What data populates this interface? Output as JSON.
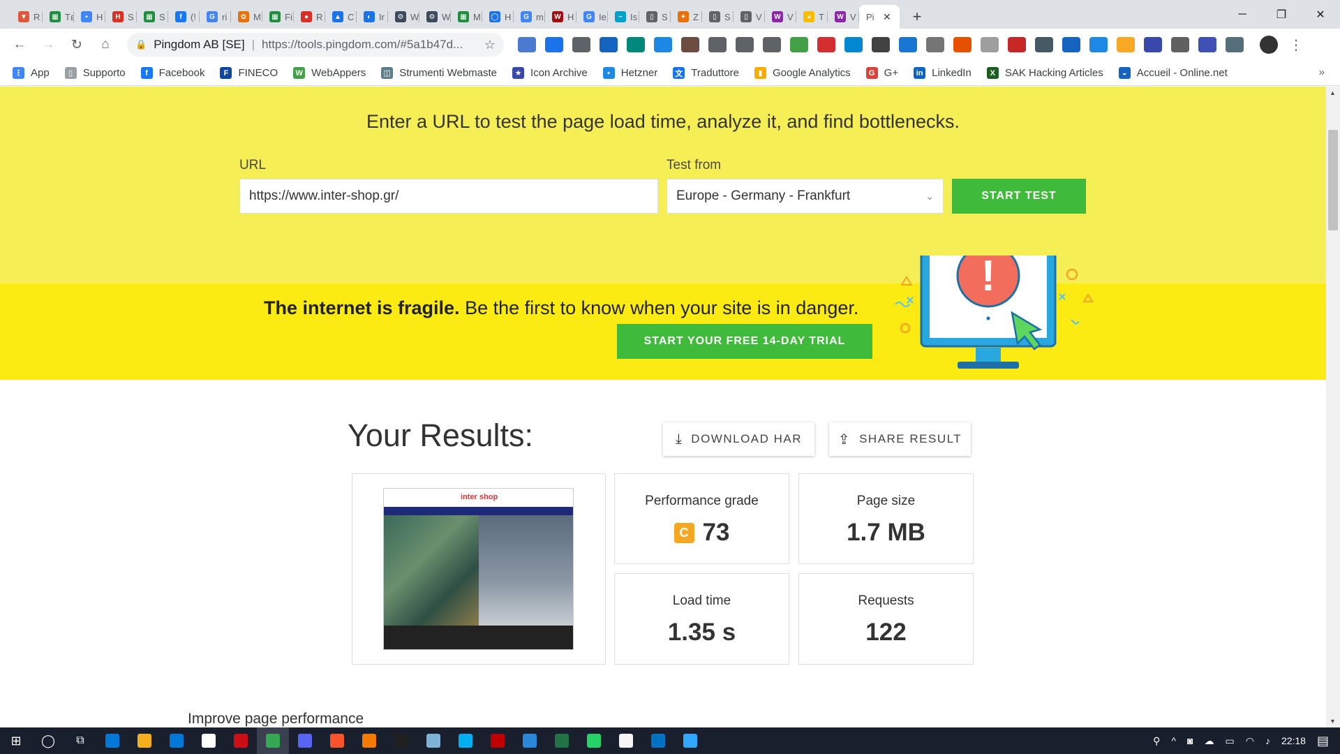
{
  "browser": {
    "tabs": [
      {
        "label": "R",
        "color": "#e0583c",
        "glyph": "▼"
      },
      {
        "label": "Tε",
        "color": "#1e8e3e",
        "glyph": "▦"
      },
      {
        "label": "H",
        "color": "#4285f4",
        "glyph": "▪"
      },
      {
        "label": "S",
        "color": "#d93025",
        "glyph": "H"
      },
      {
        "label": "S",
        "color": "#1e8e3e",
        "glyph": "▦"
      },
      {
        "label": "(!",
        "color": "#1877f2",
        "glyph": "f"
      },
      {
        "label": "ri",
        "color": "#4285f4",
        "glyph": "G"
      },
      {
        "label": "M",
        "color": "#e8710a",
        "glyph": "✿"
      },
      {
        "label": "Fi",
        "color": "#1e8e3e",
        "glyph": "▦"
      },
      {
        "label": "R",
        "color": "#d93025",
        "glyph": "●"
      },
      {
        "label": "C",
        "color": "#1a73e8",
        "glyph": "▲"
      },
      {
        "label": "Ir",
        "color": "#1a73e8",
        "glyph": "◐"
      },
      {
        "label": "W",
        "color": "#3c4a5c",
        "glyph": "⚙"
      },
      {
        "label": "W",
        "color": "#3c4a5c",
        "glyph": "⚙"
      },
      {
        "label": "M",
        "color": "#1e8e3e",
        "glyph": "▦"
      },
      {
        "label": "H",
        "color": "#1a73e8",
        "glyph": "◯"
      },
      {
        "label": "m",
        "color": "#4285f4",
        "glyph": "G"
      },
      {
        "label": "H",
        "color": "#a50e0e",
        "glyph": "W"
      },
      {
        "label": "Ie",
        "color": "#4285f4",
        "glyph": "G"
      },
      {
        "label": "Is",
        "color": "#00a1c9",
        "glyph": "~"
      },
      {
        "label": "S",
        "color": "#5f6368",
        "glyph": "▯"
      },
      {
        "label": "Z",
        "color": "#e8710a",
        "glyph": "✦"
      },
      {
        "label": "S",
        "color": "#5f6368",
        "glyph": "▯"
      },
      {
        "label": "V",
        "color": "#5f6368",
        "glyph": "▯"
      },
      {
        "label": "V",
        "color": "#8e24aa",
        "glyph": "W"
      },
      {
        "label": "T",
        "color": "#fbbc04",
        "glyph": "◕"
      },
      {
        "label": "V",
        "color": "#8e24aa",
        "glyph": "W"
      }
    ],
    "active_tab": {
      "label": "Pi",
      "close": "✕"
    },
    "new_tab": "+",
    "window_controls": {
      "minimize": "─",
      "maximize": "❐",
      "close": "✕"
    },
    "nav": {
      "back": "←",
      "forward": "→",
      "reload": "↻",
      "home": "⌂"
    },
    "omnibox": {
      "origin": "Pingdom AB [SE]",
      "separator": "|",
      "url": "https://tools.pingdom.com/#5a1b47d...",
      "star": "☆",
      "lock": "🔒"
    },
    "extension_colors": [
      "#4a7bd0",
      "#1a73e8",
      "#5f6368",
      "#1565c0",
      "#00897b",
      "#1e88e5",
      "#6d4c41",
      "#5f6368",
      "#5f6368",
      "#5f6368",
      "#43a047",
      "#d32f2f",
      "#0288d1",
      "#424242",
      "#1976d2",
      "#757575",
      "#e65100",
      "#9e9e9e",
      "#c62828",
      "#455a64",
      "#1565c0",
      "#1e88e5",
      "#f9a825",
      "#3949ab",
      "#616161",
      "#3f51b5",
      "#546e7a"
    ],
    "menu": "⋮"
  },
  "bookmarks": [
    {
      "label": "App",
      "color": "#4285f4",
      "glyph": "⋮"
    },
    {
      "label": "Supporto",
      "color": "#9aa0a6",
      "glyph": "▯"
    },
    {
      "label": "Facebook",
      "color": "#1877f2",
      "glyph": "f"
    },
    {
      "label": "FINECO",
      "color": "#0d47a1",
      "glyph": "F"
    },
    {
      "label": "WebAppers",
      "color": "#43a047",
      "glyph": "W"
    },
    {
      "label": "Strumenti Webmaste",
      "color": "#607d8b",
      "glyph": "◫"
    },
    {
      "label": "Icon Archive",
      "color": "#3949ab",
      "glyph": "★"
    },
    {
      "label": "Hetzner",
      "color": "#1e88e5",
      "glyph": "▪"
    },
    {
      "label": "Traduttore",
      "color": "#1a73e8",
      "glyph": "文"
    },
    {
      "label": "Google Analytics",
      "color": "#f9ab00",
      "glyph": "▮"
    },
    {
      "label": "G+",
      "color": "#db4437",
      "glyph": "G"
    },
    {
      "label": "LinkedIn",
      "color": "#0a66c2",
      "glyph": "in"
    },
    {
      "label": "SAK Hacking Articles",
      "color": "#1b5e20",
      "glyph": "X"
    },
    {
      "label": "Accueil - Online.net",
      "color": "#1565c0",
      "glyph": "◒"
    }
  ],
  "bookmarks_more": "»",
  "hero": {
    "subtitle": "Enter a URL to test the page load time, analyze it, and find bottlenecks.",
    "url_label": "URL",
    "url_value": "https://www.inter-shop.gr/",
    "test_from_label": "Test from",
    "test_from_value": "Europe - Germany - Frankfurt",
    "start_test": "START TEST"
  },
  "promo": {
    "headline_bold": "The internet is fragile.",
    "headline_rest": " Be the first to know when your site is in danger.",
    "trial_button": "START YOUR FREE 14-DAY TRIAL",
    "alert_glyph": "!"
  },
  "results": {
    "title": "Your Results:",
    "download_har": "DOWNLOAD HAR",
    "share_result": "SHARE RESULT",
    "performance_grade_label": "Performance grade",
    "performance_grade_letter": "C",
    "performance_grade_value": "73",
    "page_size_label": "Page size",
    "page_size_value": "1.7 MB",
    "load_time_label": "Load time",
    "load_time_value": "1.35 s",
    "requests_label": "Requests",
    "requests_value": "122",
    "screenshot": {
      "logo": "inter shop"
    }
  },
  "improve_heading": "Improve page performance",
  "taskbar": {
    "app_colors": [
      "#0078d7",
      "#f2b01e",
      "#0078d7",
      "#ffffff",
      "#cc0f16",
      "#34a853",
      "#5865f2",
      "#fb542b",
      "#f57c00",
      "#202020",
      "#7fb3d5",
      "#00aff0",
      "#c00000",
      "#2b88d8",
      "#217346",
      "#25d366",
      "#f5f5f5",
      "#0072c6",
      "#31a8ff"
    ],
    "active_index": 5,
    "time": "22:18",
    "tray_icons": [
      "⚲",
      "^",
      "◙",
      "☁",
      "▭",
      "◠",
      "♪"
    ],
    "notification": "▤"
  }
}
